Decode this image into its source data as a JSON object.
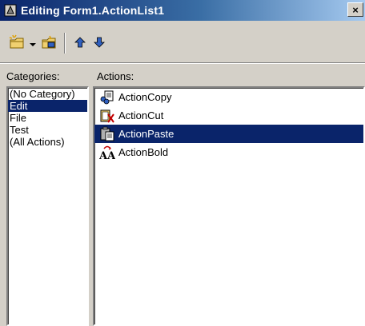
{
  "window": {
    "title": "Editing Form1.ActionList1",
    "close_glyph": "×"
  },
  "toolbar": {
    "new_action_icon": "new-action-icon",
    "dropdown_icon": "dropdown-arrow-icon",
    "new_std_action_icon": "new-standard-action-icon",
    "move_up_icon": "arrow-up-icon",
    "move_down_icon": "arrow-down-icon"
  },
  "categories": {
    "label": "Categories:",
    "items": [
      "(No Category)",
      "Edit",
      "File",
      "Test",
      "(All Actions)"
    ],
    "selected": "Edit"
  },
  "actions": {
    "label": "Actions:",
    "items": [
      {
        "name": "ActionCopy",
        "icon": "copy-icon"
      },
      {
        "name": "ActionCut",
        "icon": "cut-icon"
      },
      {
        "name": "ActionPaste",
        "icon": "paste-icon"
      },
      {
        "name": "ActionBold",
        "icon": "bold-icon"
      }
    ],
    "selected": "ActionPaste"
  },
  "colors": {
    "selection": "#0a246a",
    "face": "#d4d0c8"
  }
}
